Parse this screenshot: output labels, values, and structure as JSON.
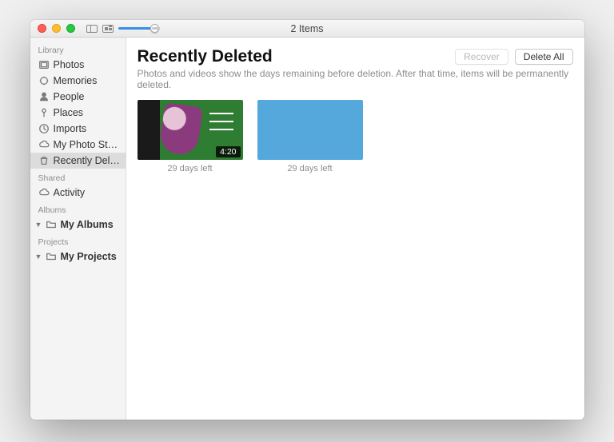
{
  "window": {
    "title": "2 Items"
  },
  "sidebar": {
    "sections": [
      {
        "header": "Library",
        "items": [
          {
            "icon": "photos",
            "label": "Photos"
          },
          {
            "icon": "memories",
            "label": "Memories"
          },
          {
            "icon": "people",
            "label": "People"
          },
          {
            "icon": "places",
            "label": "Places"
          },
          {
            "icon": "imports",
            "label": "Imports"
          },
          {
            "icon": "cloud",
            "label": "My Photo Stre…"
          },
          {
            "icon": "trash",
            "label": "Recently Delet…",
            "selected": true
          }
        ]
      },
      {
        "header": "Shared",
        "items": [
          {
            "icon": "cloud",
            "label": "Activity"
          }
        ]
      },
      {
        "header": "Albums",
        "items": [
          {
            "icon": "folder",
            "label": "My Albums",
            "disclosure": true,
            "bold": true
          }
        ]
      },
      {
        "header": "Projects",
        "items": [
          {
            "icon": "folder",
            "label": "My Projects",
            "disclosure": true,
            "bold": true
          }
        ]
      }
    ]
  },
  "main": {
    "title": "Recently Deleted",
    "recover_label": "Recover",
    "delete_all_label": "Delete All",
    "subtitle": "Photos and videos show the days remaining before deletion. After that time, items will be permanently deleted.",
    "items": [
      {
        "duration": "4:20",
        "caption": "29 days left"
      },
      {
        "caption": "29 days left"
      }
    ]
  }
}
